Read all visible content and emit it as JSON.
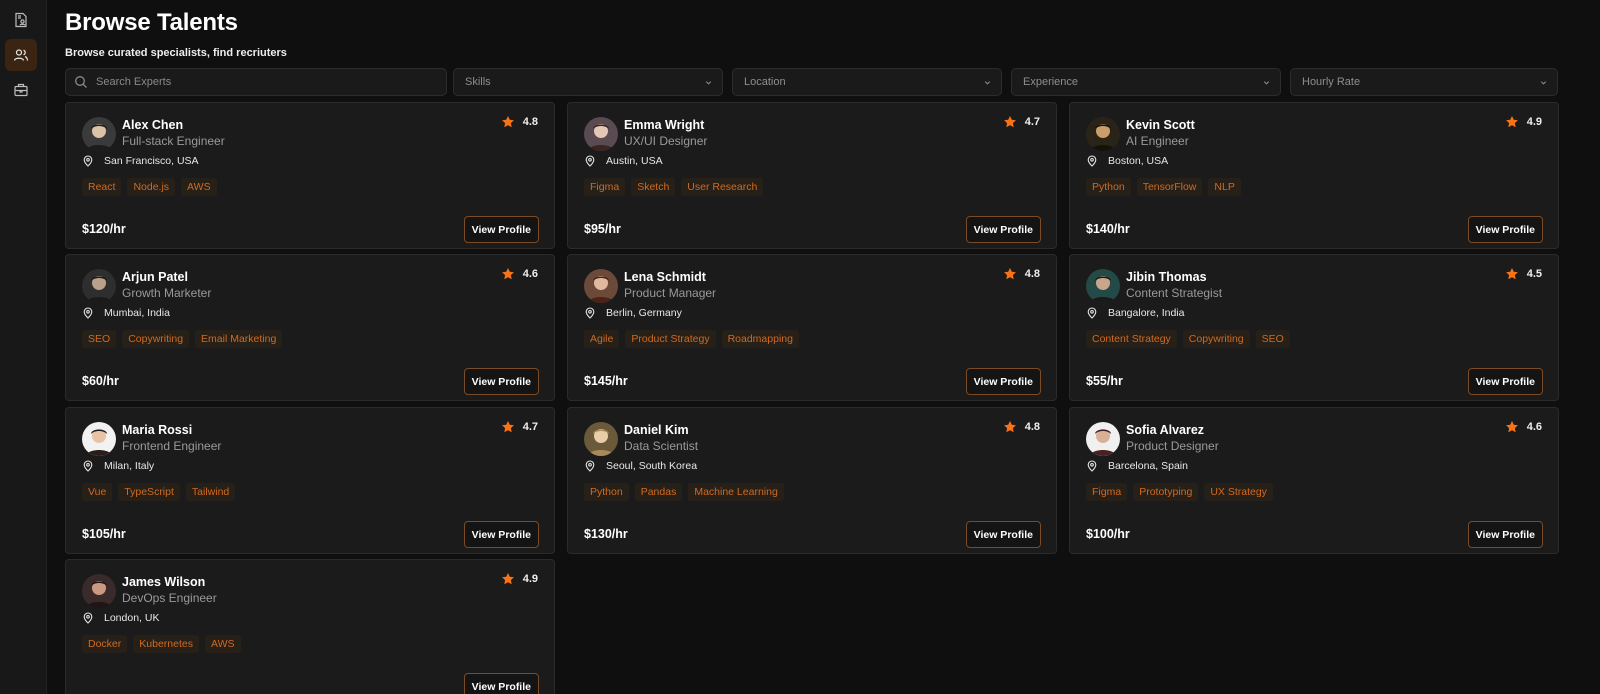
{
  "page": {
    "title": "Browse Talents",
    "subtitle": "Browse curated specialists, find recriuters"
  },
  "sidebar": {
    "items": [
      {
        "icon": "document-user-icon",
        "active": false
      },
      {
        "icon": "users-icon",
        "active": true
      },
      {
        "icon": "briefcase-icon",
        "active": false
      }
    ]
  },
  "filters": {
    "search_placeholder": "Search Experts",
    "selects": [
      "Skills",
      "Location",
      "Experience",
      "Hourly Rate"
    ]
  },
  "view_label": "View Profile",
  "colors": {
    "accent": "#f97316",
    "tag_text": "#d06a20",
    "background": "#0f0f0f",
    "card": "#1b1b1b"
  },
  "talents": [
    {
      "name": "Alex Chen",
      "role": "Full-stack Engineer",
      "rating": "4.8",
      "location": "San Francisco, USA",
      "tags": [
        "React",
        "Node.js",
        "AWS"
      ],
      "rate": "$120/hr"
    },
    {
      "name": "Emma Wright",
      "role": "UX/UI Designer",
      "rating": "4.7",
      "location": "Austin, USA",
      "tags": [
        "Figma",
        "Sketch",
        "User Research"
      ],
      "rate": "$95/hr"
    },
    {
      "name": "Kevin Scott",
      "role": "AI Engineer",
      "rating": "4.9",
      "location": "Boston, USA",
      "tags": [
        "Python",
        "TensorFlow",
        "NLP"
      ],
      "rate": "$140/hr"
    },
    {
      "name": "Arjun Patel",
      "role": "Growth Marketer",
      "rating": "4.6",
      "location": "Mumbai, India",
      "tags": [
        "SEO",
        "Copywriting",
        "Email Marketing"
      ],
      "rate": "$60/hr"
    },
    {
      "name": "Lena Schmidt",
      "role": "Product Manager",
      "rating": "4.8",
      "location": "Berlin, Germany",
      "tags": [
        "Agile",
        "Product Strategy",
        "Roadmapping"
      ],
      "rate": "$145/hr"
    },
    {
      "name": "Jibin Thomas",
      "role": "Content Strategist",
      "rating": "4.5",
      "location": "Bangalore, India",
      "tags": [
        "Content Strategy",
        "Copywriting",
        "SEO"
      ],
      "rate": "$55/hr"
    },
    {
      "name": "Maria Rossi",
      "role": "Frontend Engineer",
      "rating": "4.7",
      "location": "Milan, Italy",
      "tags": [
        "Vue",
        "TypeScript",
        "Tailwind"
      ],
      "rate": "$105/hr"
    },
    {
      "name": "Daniel Kim",
      "role": "Data Scientist",
      "rating": "4.8",
      "location": "Seoul, South Korea",
      "tags": [
        "Python",
        "Pandas",
        "Machine Learning"
      ],
      "rate": "$130/hr"
    },
    {
      "name": "Sofia Alvarez",
      "role": "Product Designer",
      "rating": "4.6",
      "location": "Barcelona, Spain",
      "tags": [
        "Figma",
        "Prototyping",
        "UX Strategy"
      ],
      "rate": "$100/hr"
    },
    {
      "name": "James Wilson",
      "role": "DevOps Engineer",
      "rating": "4.9",
      "location": "London, UK",
      "tags": [
        "Docker",
        "Kubernetes",
        "AWS"
      ],
      "rate": ""
    }
  ]
}
